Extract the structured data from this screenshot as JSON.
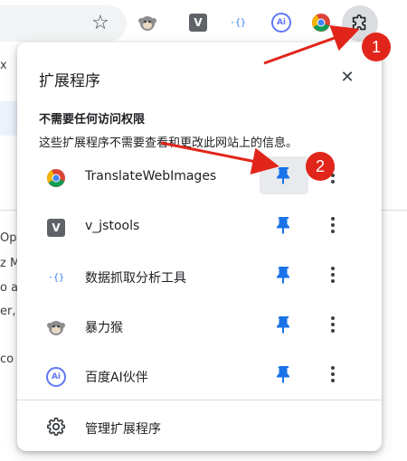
{
  "browser": {
    "toolbar_icons": [
      "star-icon",
      "monkey-extension-icon",
      "v-extension-icon",
      "js-extension-icon",
      "ai-extension-icon",
      "chrome-extension-icon",
      "puzzle-icon"
    ],
    "v_icon_letter": "V",
    "js_icon_text": "·{}",
    "ai_icon_text": "Ai",
    "background_text": [
      "x",
      "Op",
      "z M",
      "o ap",
      "er,",
      "co"
    ]
  },
  "popup": {
    "title": "扩展程序",
    "section_heading": "不需要任何访问权限",
    "section_description": "这些扩展程序不需要查看和更改此网站上的信息。",
    "extensions": [
      {
        "name": "TranslateWebImages",
        "icon": "chrome-icon",
        "pinned": true
      },
      {
        "name": "v_jstools",
        "icon": "v-icon",
        "pinned": true
      },
      {
        "name": "数据抓取分析工具",
        "icon": "js-icon",
        "pinned": true
      },
      {
        "name": "暴力猴",
        "icon": "monkey-icon",
        "pinned": true
      },
      {
        "name": "百度AI伙伴",
        "icon": "ai-icon",
        "pinned": true
      }
    ],
    "manage_label": "管理扩展程序"
  },
  "annotations": {
    "badge_1": "1",
    "badge_2": "2",
    "color": "#e1251b"
  },
  "colors": {
    "pin_blue": "#1a73e8",
    "popup_bg": "#ffffff",
    "hover_bg": "#e8eaed"
  }
}
